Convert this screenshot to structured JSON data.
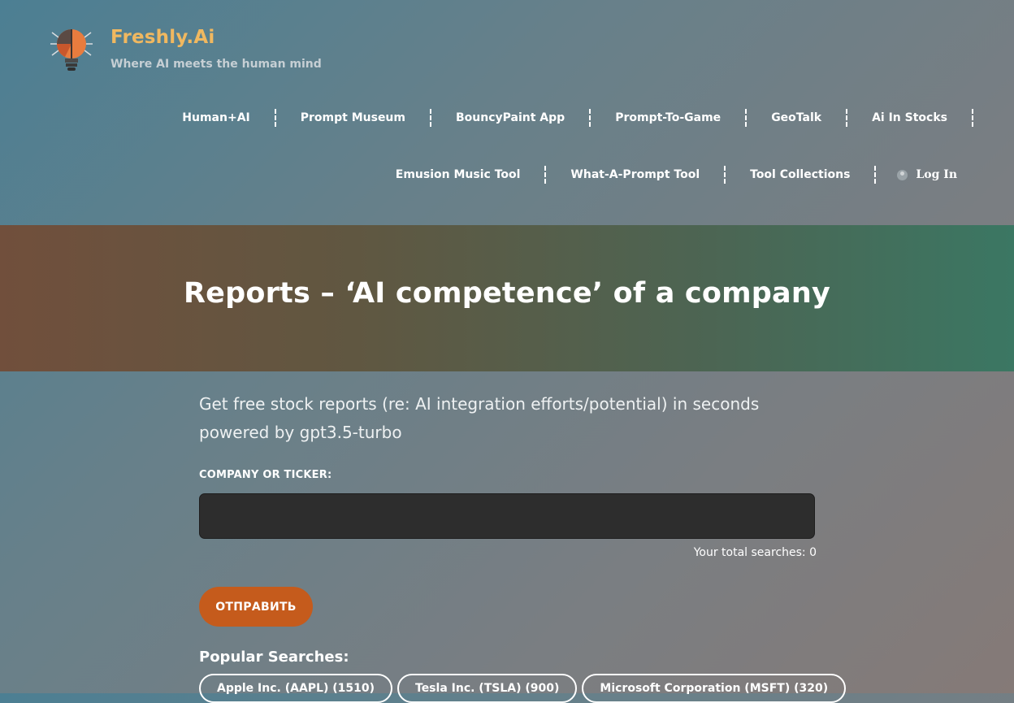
{
  "brand": {
    "title": "Freshly.Ai",
    "tagline": "Where AI meets the human mind"
  },
  "nav": {
    "row1": [
      "Human+AI",
      "Prompt Museum",
      "BouncyPaint App",
      "Prompt-To-Game",
      "GeoTalk",
      "Ai In Stocks"
    ],
    "row2": [
      "Emusion Music Tool",
      "What-A-Prompt Tool",
      "Tool Collections"
    ],
    "login_label": "Log In"
  },
  "hero": {
    "title": "Reports – ‘AI competence’ of a company"
  },
  "form": {
    "intro_line1": "Get free stock reports (re: AI integration efforts/potential) in seconds",
    "intro_line2": "powered by gpt3.5-turbo",
    "field_label": "COMPANY OR TICKER:",
    "input_value": "",
    "searches_text": "Your total searches: 0",
    "submit_label": "ОТПРАВИТЬ"
  },
  "popular": {
    "title": "Popular Searches:",
    "items": [
      "Apple Inc. (AAPL) (1510)",
      "Tesla Inc. (TSLA) (900)",
      "Microsoft Corporation (MSFT) (320)"
    ]
  },
  "colors": {
    "brand": "#f0b860",
    "button": "#c55b1c",
    "input_bg": "#2d2d2d"
  },
  "icons": {
    "logo": "lightbulb-brain-icon",
    "login": "user-icon"
  }
}
